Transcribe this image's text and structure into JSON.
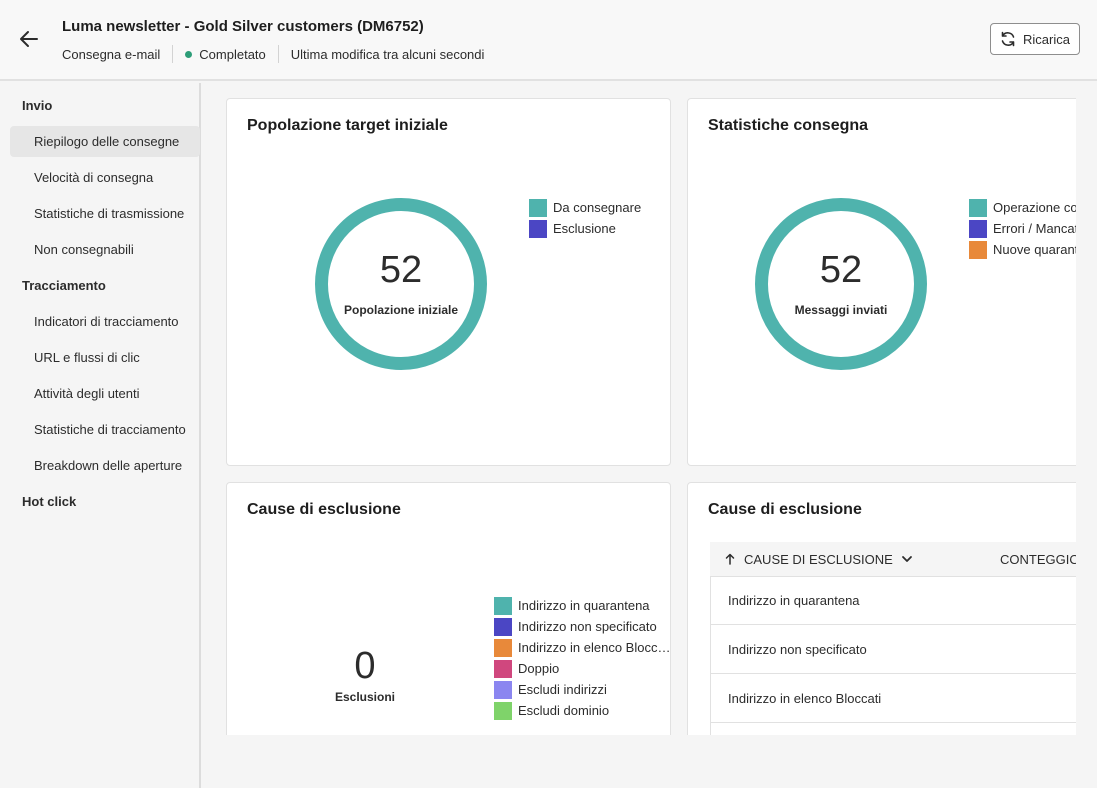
{
  "header": {
    "title": "Luma newsletter - Gold Silver customers (DM6752)",
    "channel": "Consegna e-mail",
    "status": "Completato",
    "last_modified": "Ultima modifica tra alcuni secondi",
    "reload_label": "Ricarica",
    "status_color": "#2d9d78"
  },
  "sidebar": {
    "groups": [
      {
        "label": "Invio",
        "items": [
          "Riepilogo delle consegne",
          "Velocità di consegna",
          "Statistiche di trasmissione",
          "Non consegnabili"
        ]
      },
      {
        "label": "Tracciamento",
        "items": [
          "Indicatori di tracciamento",
          "URL e flussi di clic",
          "Attività degli utenti",
          "Statistiche di tracciamento",
          "Breakdown delle aperture"
        ]
      },
      {
        "label": "Hot click",
        "items": []
      }
    ],
    "active_item": "Riepilogo delle consegne"
  },
  "cards": {
    "population": {
      "title": "Popolazione target iniziale",
      "value": "52",
      "label": "Popolazione iniziale",
      "legend": [
        {
          "label": "Da consegnare",
          "color": "#4fb3ad"
        },
        {
          "label": "Esclusione",
          "color": "#4b46c4"
        }
      ]
    },
    "delivery": {
      "title": "Statistiche consegna",
      "value": "52",
      "label": "Messaggi inviati",
      "legend": [
        {
          "label": "Operazione con",
          "color": "#4fb3ad"
        },
        {
          "label": "Errori / Mancat",
          "color": "#4b46c4"
        },
        {
          "label": "Nuove quarant",
          "color": "#e8893a"
        }
      ]
    },
    "exclusions_chart": {
      "title": "Cause di esclusione",
      "value": "0",
      "label": "Esclusioni",
      "legend": [
        {
          "label": "Indirizzo in quarantena",
          "color": "#4fb3ad"
        },
        {
          "label": "Indirizzo non specificato",
          "color": "#4b46c4"
        },
        {
          "label": "Indirizzo in elenco Blocc…",
          "color": "#e8893a"
        },
        {
          "label": "Doppio",
          "color": "#d0477e"
        },
        {
          "label": "Escludi indirizzi",
          "color": "#8b86f0"
        },
        {
          "label": "Escludi dominio",
          "color": "#7fd36a"
        }
      ]
    },
    "exclusions_table": {
      "title": "Cause di esclusione",
      "col1": "CAUSE DI ESCLUSIONE",
      "col2": "CONTEGGIO",
      "rows": [
        "Indirizzo in quarantena",
        "Indirizzo non specificato",
        "Indirizzo in elenco Bloccati"
      ]
    }
  },
  "icons": {
    "back": "arrow-left-icon",
    "reload": "refresh-icon",
    "sort": "arrow-up-icon",
    "menu": "chevron-down-icon"
  }
}
